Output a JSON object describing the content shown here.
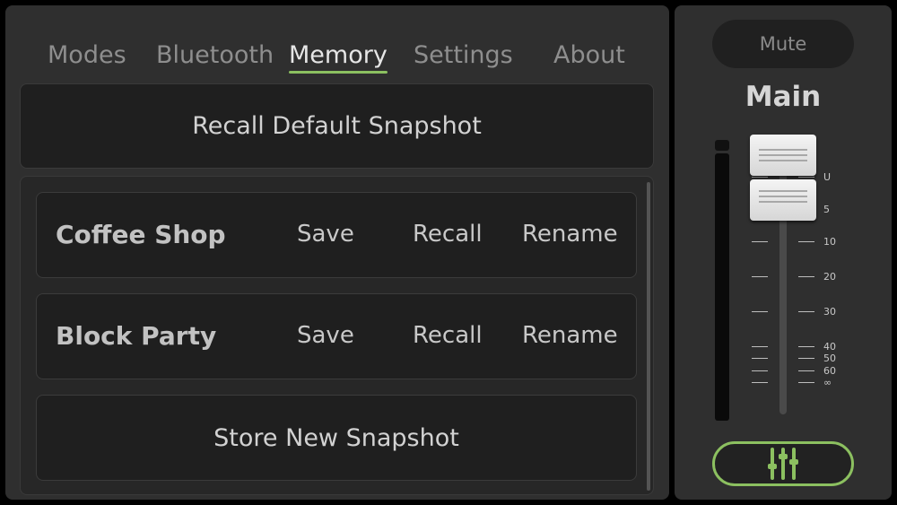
{
  "tabs": [
    {
      "label": "Modes"
    },
    {
      "label": "Bluetooth"
    },
    {
      "label": "Memory"
    },
    {
      "label": "Settings"
    },
    {
      "label": "About"
    }
  ],
  "active_tab": "Memory",
  "recall_default_label": "Recall Default Snapshot",
  "snapshots": [
    {
      "name": "Coffee Shop",
      "save": "Save",
      "recall": "Recall",
      "rename": "Rename"
    },
    {
      "name": "Block Party",
      "save": "Save",
      "recall": "Recall",
      "rename": "Rename"
    }
  ],
  "store_new_label": "Store New Snapshot",
  "side": {
    "mute_label": "Mute",
    "channel_label": "Main",
    "scale_labels": [
      "U",
      "5",
      "10",
      "20",
      "30",
      "40",
      "50",
      "60",
      "∞"
    ],
    "mixer_icon": "mixer-sliders-icon"
  },
  "colors": {
    "accent": "#8cc060",
    "panel": "#2f2f2f",
    "button_bg": "#1f1f1f",
    "text_active": "#e6e6e6",
    "text_inactive": "#8e8e8e"
  }
}
